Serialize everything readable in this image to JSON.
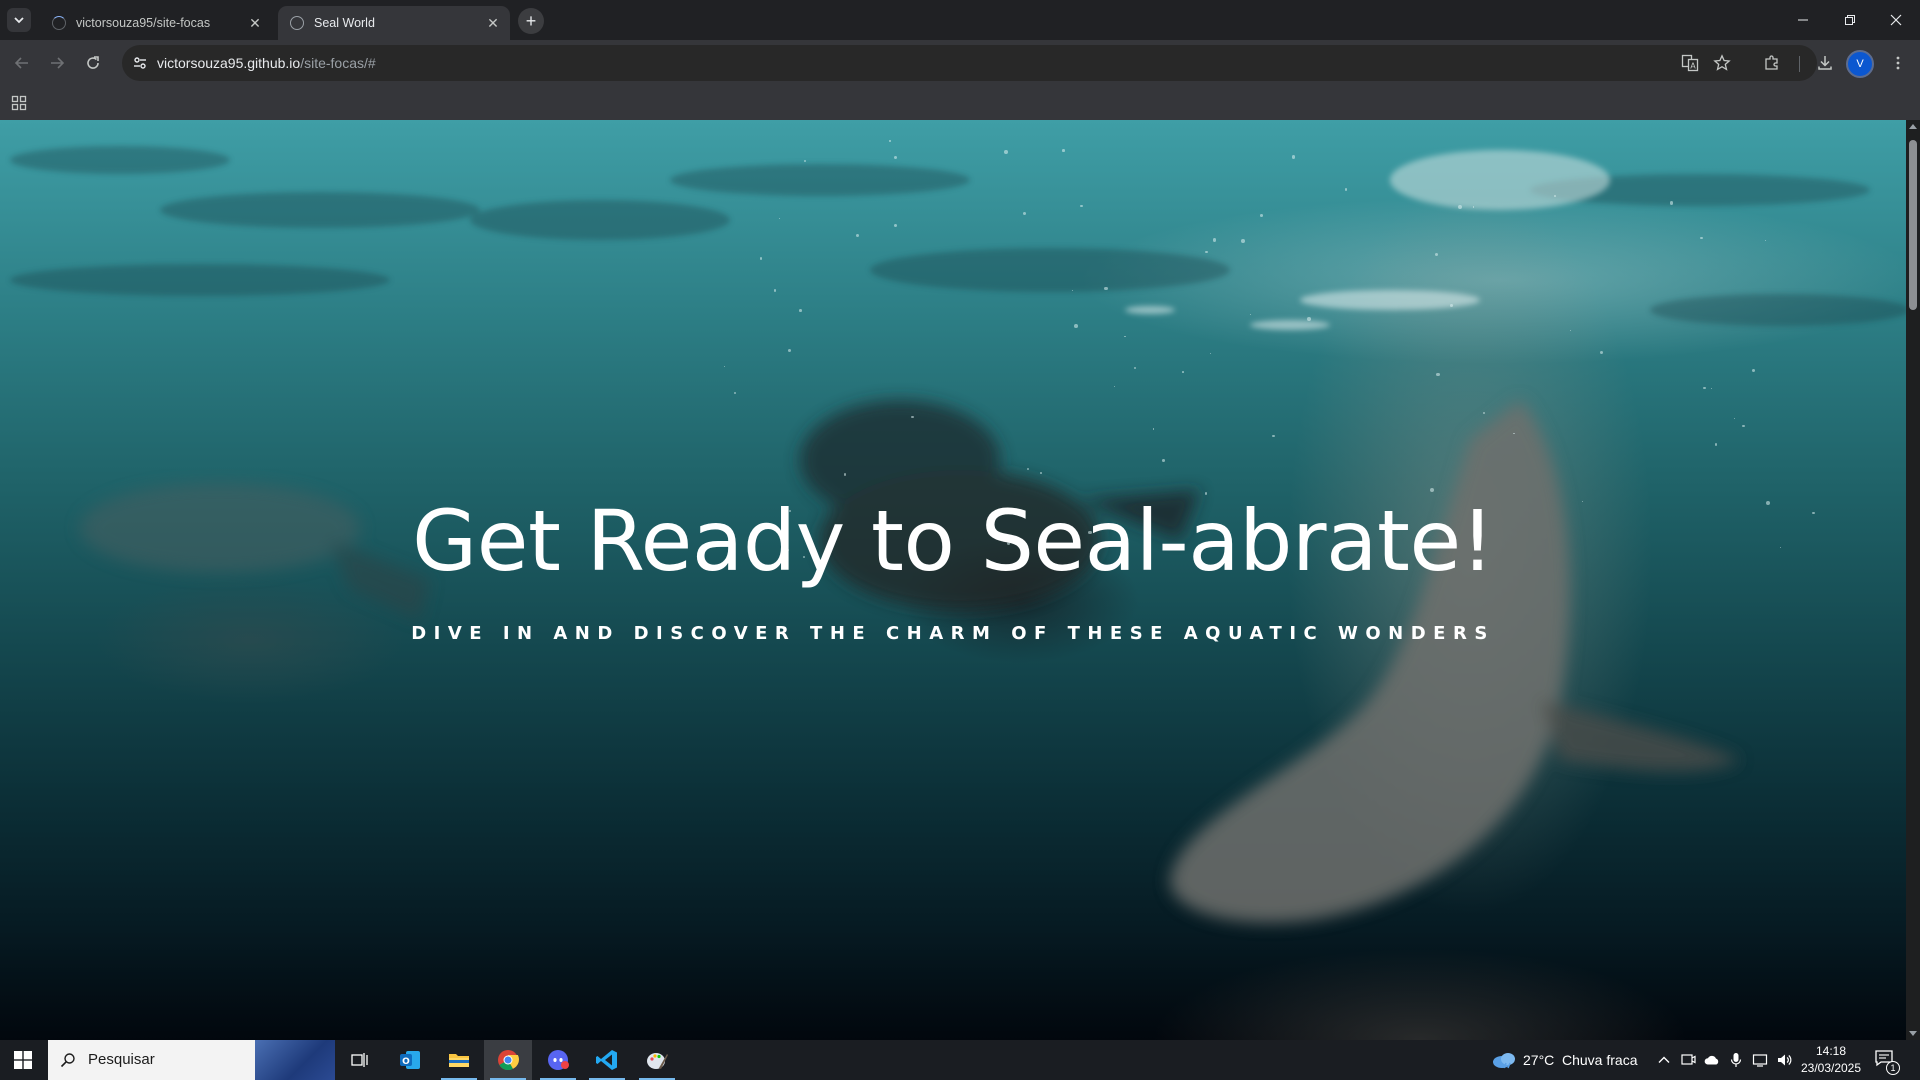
{
  "browser": {
    "tabs": [
      {
        "title": "victorsouza95/site-focas",
        "active": false
      },
      {
        "title": "Seal World",
        "active": true
      }
    ],
    "address": {
      "host": "victorsouza95.github.io",
      "path": "/site-focas/#"
    },
    "profile_initial": "V"
  },
  "page": {
    "title": "Get Ready to Seal-abrate!",
    "subtitle": "DIVE IN AND DISCOVER THE CHARM OF THESE AQUATIC WONDERS"
  },
  "taskbar": {
    "search_placeholder": "Pesquisar",
    "weather": {
      "temp": "27°C",
      "condition": "Chuva fraca"
    },
    "time": "14:18",
    "date": "23/03/2025",
    "notification_count": "1"
  }
}
